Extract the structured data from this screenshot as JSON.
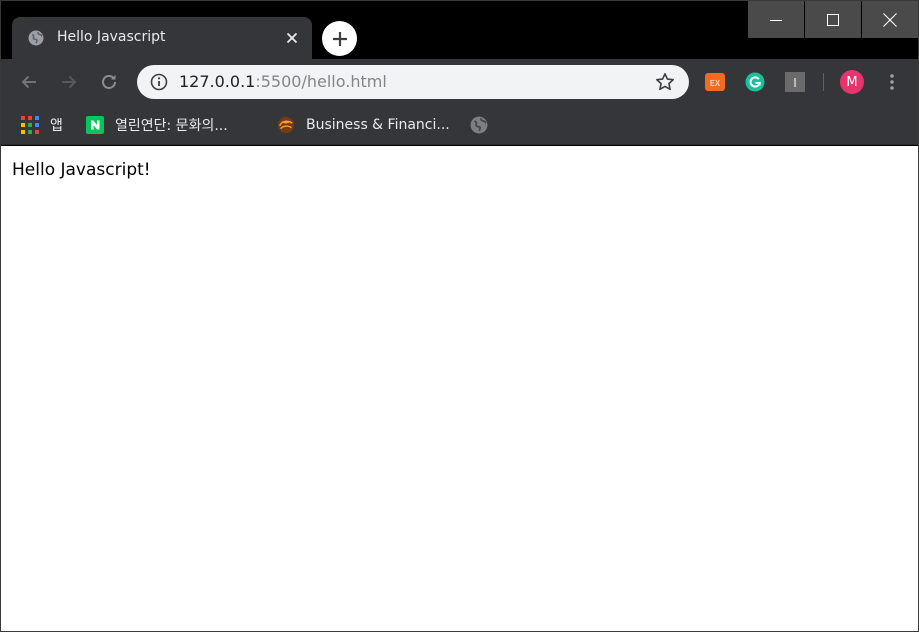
{
  "tab": {
    "title": "Hello Javascript",
    "favicon": "globe-icon"
  },
  "window_controls": {
    "minimize": "minimize-icon",
    "maximize": "maximize-icon",
    "close": "close-icon"
  },
  "omnibox": {
    "url_host": "127.0.0.1",
    "url_rest": ":5500/hello.html"
  },
  "extensions": {
    "ex_label": "EX",
    "ex_color": "#f26b21",
    "grammarly_label": "G",
    "grammarly_color": "#15c39a",
    "i_label": "I"
  },
  "profile": {
    "initial": "M",
    "color": "#e8336d"
  },
  "bookmarks": [
    {
      "label": "앱",
      "icon": "apps-grid-icon"
    },
    {
      "label": "열린연단: 문화의...",
      "icon": "naver-icon"
    },
    {
      "label": "Business & Financi...",
      "icon": "business-icon"
    },
    {
      "label": "",
      "icon": "globe-icon"
    }
  ],
  "page": {
    "content": "Hello Javascript!"
  }
}
